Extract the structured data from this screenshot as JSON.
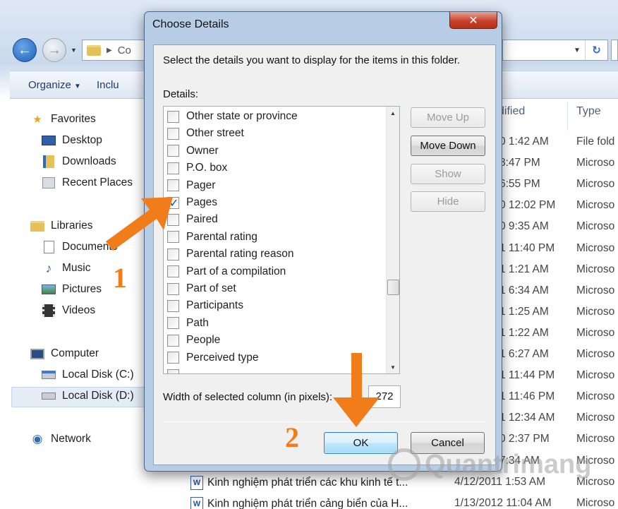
{
  "explorer": {
    "address_partial": "Co",
    "toolbar": {
      "organize": "Organize",
      "include_partial": "Inclu"
    },
    "sidebar": {
      "favorites": "Favorites",
      "desktop": "Desktop",
      "downloads": "Downloads",
      "recent_places": "Recent Places",
      "libraries": "Libraries",
      "documents": "Documents",
      "music": "Music",
      "pictures": "Pictures",
      "videos": "Videos",
      "computer": "Computer",
      "local_disk_c": "Local Disk (C:)",
      "local_disk_d": "Local Disk (D:)",
      "network": "Network"
    },
    "columns": {
      "modified_partial": "dified",
      "type": "Type"
    },
    "modified_partial": [
      "0 1:42 AM",
      "8:47 PM",
      "6:55 PM",
      "0 12:02 PM",
      "0 9:35 AM",
      "1 11:40 PM",
      "1 1:21 AM",
      "1 6:34 AM",
      "1 1:25 AM",
      "1 1:22 AM",
      "1 6:27 AM",
      "1 11:44 PM",
      "1 11:46 PM",
      "1 12:34 AM",
      "0 2:37 PM",
      "7:34 AM"
    ],
    "types": [
      "File fold",
      "Microso",
      "Microso",
      "Microso",
      "Microso",
      "Microso",
      "Microso",
      "Microso",
      "Microso",
      "Microso",
      "Microso",
      "Microso",
      "Microso",
      "Microso",
      "Microso",
      "Microso",
      "Microso",
      "Microso"
    ],
    "files": [
      {
        "name": "Kinh nghiệm phát triển các khu kinh tế t...",
        "date": "4/12/2011 1:53 AM"
      },
      {
        "name": "Kinh nghiệm phát triển cảng biển của H...",
        "date": "1/13/2012 11:04 AM"
      }
    ]
  },
  "dialog": {
    "title": "Choose Details",
    "close_glyph": "✕",
    "instruction": "Select the details you want to display for the items in this folder.",
    "details_label": "Details:",
    "items": [
      {
        "label": "Other state or province",
        "checked": false
      },
      {
        "label": "Other street",
        "checked": false
      },
      {
        "label": "Owner",
        "checked": false
      },
      {
        "label": "P.O. box",
        "checked": false
      },
      {
        "label": "Pager",
        "checked": false
      },
      {
        "label": "Pages",
        "checked": true
      },
      {
        "label": "Paired",
        "checked": false
      },
      {
        "label": "Parental rating",
        "checked": false
      },
      {
        "label": "Parental rating reason",
        "checked": false
      },
      {
        "label": "Part of a compilation",
        "checked": false
      },
      {
        "label": "Part of set",
        "checked": false
      },
      {
        "label": "Participants",
        "checked": false
      },
      {
        "label": "Path",
        "checked": false
      },
      {
        "label": "People",
        "checked": false
      },
      {
        "label": "Perceived type",
        "checked": false
      }
    ],
    "buttons": {
      "move_up": "Move Up",
      "move_down": "Move Down",
      "show": "Show",
      "hide": "Hide",
      "ok": "OK",
      "cancel": "Cancel"
    },
    "width_label": "Width of selected column (in pixels):",
    "width_value": "272"
  },
  "annotations": {
    "step1": "1",
    "step2": "2",
    "color": "#f07d1a"
  },
  "watermark": "Quantrimang"
}
